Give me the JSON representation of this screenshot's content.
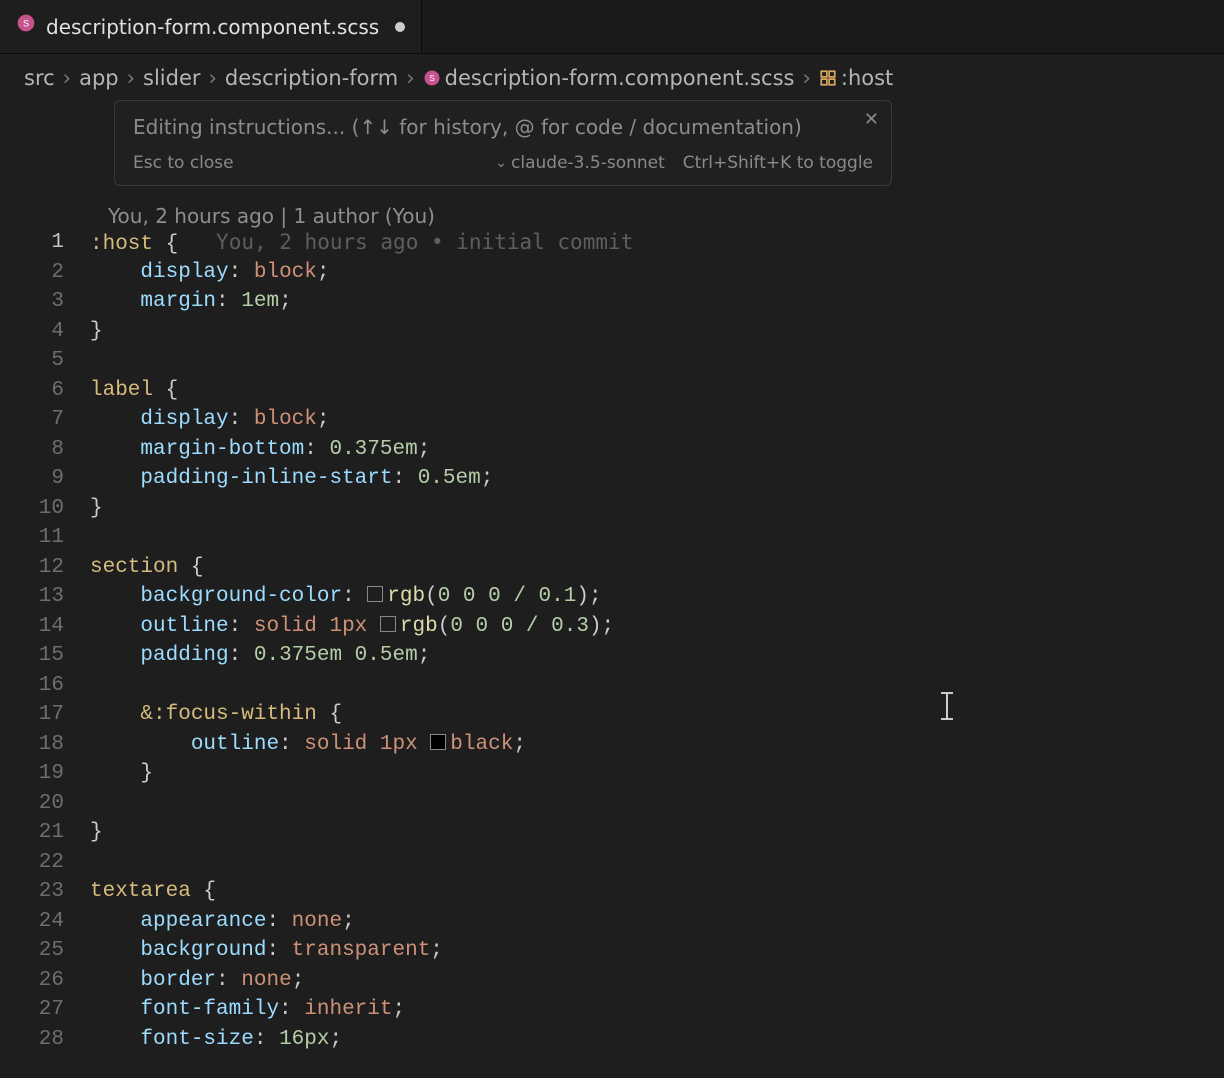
{
  "tab": {
    "filename": "description-form.component.scss"
  },
  "breadcrumbs": {
    "items": [
      "src",
      "app",
      "slider",
      "description-form",
      "description-form.component.scss",
      ":host"
    ]
  },
  "inline_prompt": {
    "placeholder": "Editing instructions... (↑↓ for history, @ for code / documentation)",
    "esc_hint": "Esc to close",
    "model": "claude-3.5-sonnet",
    "shortcut": "Ctrl+Shift+K to toggle"
  },
  "blame": {
    "header": "You, 2 hours ago | 1 author (You)",
    "inline": "You, 2 hours ago • initial commit"
  },
  "code": {
    "lines": [
      {
        "n": 1,
        "sel": ":host ",
        "brace": "{"
      },
      {
        "n": 2,
        "indent": "    ",
        "prop": "display",
        "val": "block"
      },
      {
        "n": 3,
        "indent": "    ",
        "prop": "margin",
        "val": "1em"
      },
      {
        "n": 4,
        "brace": "}"
      },
      {
        "n": 5
      },
      {
        "n": 6,
        "sel": "label ",
        "brace": "{"
      },
      {
        "n": 7,
        "indent": "    ",
        "prop": "display",
        "val": "block"
      },
      {
        "n": 8,
        "indent": "    ",
        "prop": "margin-bottom",
        "val": "0.375em"
      },
      {
        "n": 9,
        "indent": "    ",
        "prop": "padding-inline-start",
        "val": "0.5em"
      },
      {
        "n": 10,
        "brace": "}"
      },
      {
        "n": 11
      },
      {
        "n": 12,
        "sel": "section ",
        "brace": "{"
      },
      {
        "n": 13,
        "indent": "    ",
        "prop": "background-color",
        "swatch": true,
        "func": "rgb",
        "args": "0 0 0 / 0.1"
      },
      {
        "n": 14,
        "indent": "    ",
        "prop": "outline",
        "preval": "solid 1px ",
        "swatch": true,
        "func": "rgb",
        "args": "0 0 0 / 0.3"
      },
      {
        "n": 15,
        "indent": "    ",
        "prop": "padding",
        "val": "0.375em 0.5em"
      },
      {
        "n": 16
      },
      {
        "n": 17,
        "indent": "    ",
        "sel": "&:focus-within ",
        "brace": "{"
      },
      {
        "n": 18,
        "indent": "        ",
        "prop": "outline",
        "preval": "solid 1px ",
        "swatch": "black",
        "kw": "black"
      },
      {
        "n": 19,
        "indent": "    ",
        "brace": "}"
      },
      {
        "n": 20
      },
      {
        "n": 21,
        "brace": "}"
      },
      {
        "n": 22
      },
      {
        "n": 23,
        "sel": "textarea ",
        "brace": "{"
      },
      {
        "n": 24,
        "indent": "    ",
        "prop": "appearance",
        "val": "none"
      },
      {
        "n": 25,
        "indent": "    ",
        "prop": "background",
        "val": "transparent"
      },
      {
        "n": 26,
        "indent": "    ",
        "prop": "border",
        "val": "none"
      },
      {
        "n": 27,
        "indent": "    ",
        "prop": "font-family",
        "val": "inherit"
      },
      {
        "n": 28,
        "indent": "    ",
        "prop": "font-size",
        "val": "16px",
        "cut": true
      }
    ]
  }
}
